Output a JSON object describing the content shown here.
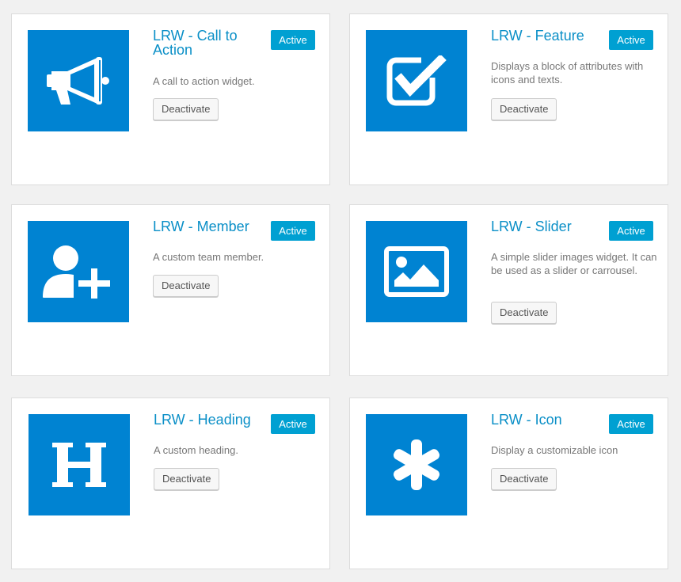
{
  "widgets": [
    {
      "title": "LRW - Call to Action",
      "status": "Active",
      "description": "A call to action widget.",
      "action_label": "Deactivate",
      "icon": "megaphone-icon"
    },
    {
      "title": "LRW - Feature",
      "status": "Active",
      "description": "Displays a block of attributes with icons and texts.",
      "action_label": "Deactivate",
      "icon": "checkbox-checked-icon"
    },
    {
      "title": "LRW - Member",
      "status": "Active",
      "description": "A custom team member.",
      "action_label": "Deactivate",
      "icon": "user-add-icon"
    },
    {
      "title": "LRW - Slider",
      "status": "Active",
      "description": "A simple slider images widget. It can be used as a slider or carrousel.",
      "action_label": "Deactivate",
      "icon": "image-icon"
    },
    {
      "title": "LRW - Heading",
      "status": "Active",
      "description": "A custom heading.",
      "action_label": "Deactivate",
      "icon": "heading-icon"
    },
    {
      "title": "LRW - Icon",
      "status": "Active",
      "description": "Display a customizable icon",
      "action_label": "Deactivate",
      "icon": "asterisk-icon"
    }
  ],
  "colors": {
    "tile": "#0083d2",
    "title": "#0a8fc7",
    "badge": "#00a0d2",
    "page_bg": "#f1f1f1"
  }
}
